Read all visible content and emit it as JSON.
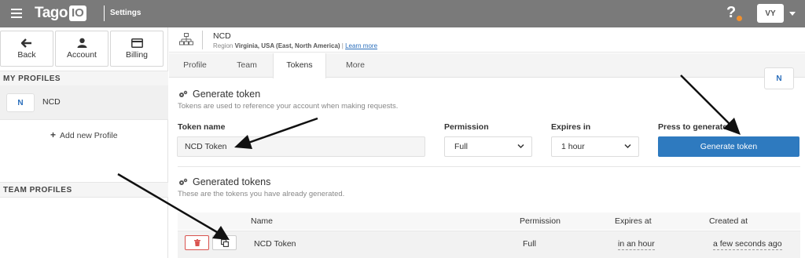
{
  "topbar": {
    "logo_text": "Tago",
    "logo_box": "IO",
    "title": "Settings",
    "help": "?",
    "user_initials": "VY",
    "help_dot_color": "#f0902f"
  },
  "sidebar": {
    "buttons": [
      {
        "label": "Back",
        "icon": "arrow-left-icon"
      },
      {
        "label": "Account",
        "icon": "user-icon"
      },
      {
        "label": "Billing",
        "icon": "credit-card-icon"
      }
    ],
    "my_profiles_header": "MY PROFILES",
    "profile": {
      "badge": "N",
      "name": "NCD"
    },
    "add_profile_icon": "+",
    "add_profile": "Add new Profile",
    "team_profiles_header": "TEAM PROFILES"
  },
  "profile_header": {
    "icon": "sitemap-icon",
    "name": "NCD",
    "region_prefix": "Region",
    "region": "Virginia, USA (East, North America)",
    "separator": "|",
    "learn_more": "Learn more"
  },
  "tabs": [
    {
      "label": "Profile",
      "active": false
    },
    {
      "label": "Team",
      "active": false
    },
    {
      "label": "Tokens",
      "active": true
    },
    {
      "label": "More",
      "active": false
    }
  ],
  "corner_badge": "N",
  "generate": {
    "title": "Generate token",
    "description": "Tokens are used to reference your account when making requests.",
    "token_name_label": "Token name",
    "token_name_value": "NCD Token",
    "permission_label": "Permission",
    "permission_value": "Full",
    "expires_label": "Expires in",
    "expires_value": "1 hour",
    "press_label": "Press to generate",
    "button_label": "Generate token",
    "button_color": "#2e7abf"
  },
  "generated": {
    "title": "Generated tokens",
    "description": "These are the tokens you have already generated.",
    "columns": [
      "Name",
      "Permission",
      "Expires at",
      "Created at"
    ],
    "rows": [
      {
        "name": "NCD Token",
        "permission": "Full",
        "expires_at": "in an hour",
        "created_at": "a few seconds ago"
      }
    ]
  }
}
